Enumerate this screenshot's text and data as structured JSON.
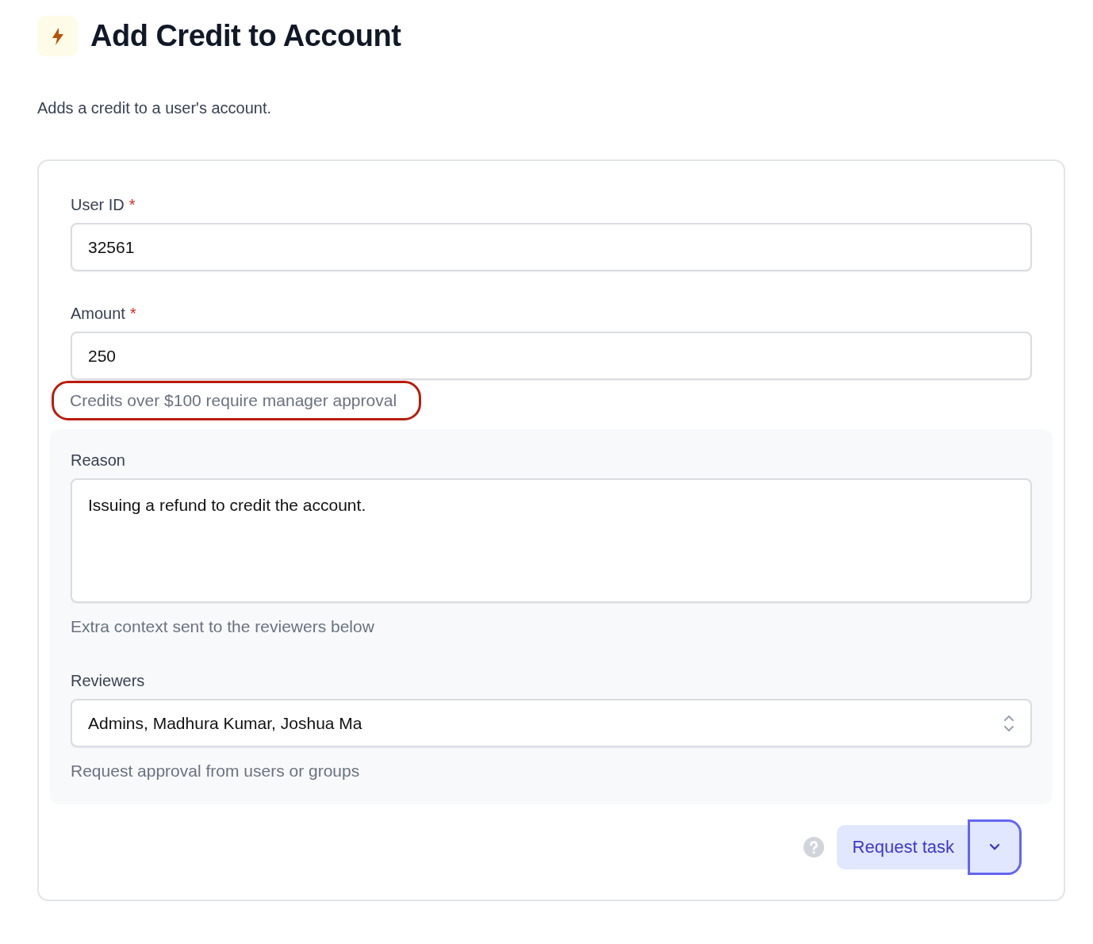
{
  "header": {
    "title": "Add Credit to Account",
    "description": "Adds a credit to a user's account."
  },
  "fields": [
    {
      "kind": "text",
      "label": "User ID",
      "required_mark": "*",
      "value": "32561"
    },
    {
      "kind": "text",
      "label": "Amount",
      "required_mark": "*",
      "value": "250",
      "hint": "Credits over $100 require manager approval",
      "hint_highlighted": true
    }
  ],
  "approval": {
    "fields": [
      {
        "kind": "textarea",
        "label": "Reason",
        "value": "Issuing a refund to credit the account.",
        "hint": "Extra context sent to the reviewers below"
      },
      {
        "kind": "select",
        "label": "Reviewers",
        "value": "Admins, Madhura Kumar, Joshua Ma",
        "hint": "Request approval from users or groups"
      }
    ]
  },
  "actions": {
    "primary": "Request task",
    "menu_focused": true
  }
}
